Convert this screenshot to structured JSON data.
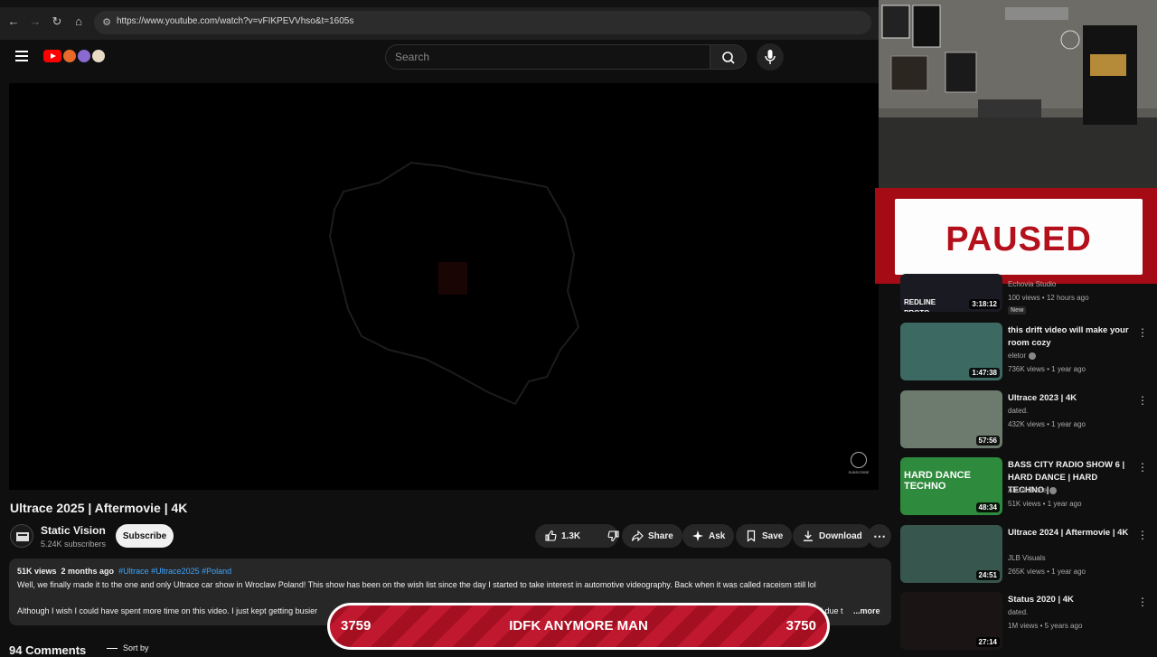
{
  "browser": {
    "url": "https://www.youtube.com/watch?v=vFIKPEVVhso&t=1605s"
  },
  "header": {
    "search_placeholder": "Search"
  },
  "video": {
    "title": "Ultrace 2025 | Aftermovie | 4K",
    "watermark": "SUBSCRIBE"
  },
  "channel": {
    "name": "Static Vision",
    "subscribers": "5.24K subscribers",
    "subscribe_label": "Subscribe"
  },
  "actions": {
    "likes": "1.3K",
    "share": "Share",
    "ask": "Ask",
    "save": "Save",
    "download": "Download"
  },
  "description": {
    "views": "51K views",
    "date": "2 months ago",
    "tags": "#Ultrace #Ultrace2025 #Poland",
    "line1": "Well, we finally made it to the one and only Ultrace car show in Wroclaw Poland! This show has been on the wish list since the day I started to take interest in automotive videography. Back when it was called raceism still lol",
    "line2": "Although I wish I could have spent more time on this video. I just kept getting busier",
    "line2_tail": "d due t",
    "more": "...more"
  },
  "comments": {
    "count": "94 Comments",
    "sort": "Sort by"
  },
  "overlay": {
    "paused": "PAUSED",
    "goal_left": "3759",
    "goal_center": "IDFK ANYMORE MAN",
    "goal_right": "3750"
  },
  "sidebar": [
    {
      "title": "",
      "channel": "Echovia Studio",
      "views": "100 views • 12 hours ago",
      "duration": "3:18:12",
      "badge": "New",
      "thumb_text": "REDLINE PROTO",
      "thumb_color": "#1a1a22"
    },
    {
      "title": "this drift video will make your room cozy",
      "channel": "eletor",
      "views": "736K views • 1 year ago",
      "duration": "1:47:38",
      "thumb_color": "#3c6a63"
    },
    {
      "title": "Ultrace 2023 | 4K",
      "channel": "dated.",
      "views": "432K views • 1 year ago",
      "duration": "57:56",
      "thumb_color": "#6d7a6e"
    },
    {
      "title": "BASS CITY RADIO SHOW 6 | HARD DANCE | HARD TECHNO |",
      "channel": "AlexisGrace",
      "views": "51K views • 1 year ago",
      "duration": "48:34",
      "thumb_text": "HARD DANCE TECHNO",
      "thumb_color": "#2e8a3c"
    },
    {
      "title": "Ultrace 2024 | Aftermovie | 4K",
      "channel": "JLB Visuals",
      "views": "265K views • 1 year ago",
      "duration": "24:51",
      "thumb_color": "#37574e"
    },
    {
      "title": "Status 2020 | 4K",
      "channel": "dated.",
      "views": "1M views • 5 years ago",
      "duration": "27:14",
      "thumb_color": "#1a1414"
    }
  ]
}
